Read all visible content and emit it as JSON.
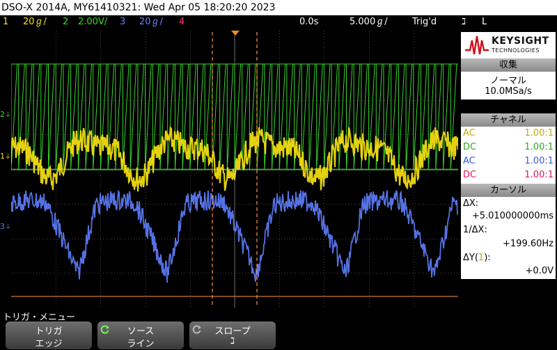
{
  "title": "DSO-X 2014A, MY61410321: Wed Apr 05 18:20:20 2023",
  "status": {
    "ch1": {
      "num": "1",
      "scale": "20ℊ/",
      "color": "#f5e21b"
    },
    "ch2": {
      "num": "2",
      "scale": "2.00V/",
      "color": "#3ddc2b"
    },
    "ch3": {
      "num": "3",
      "scale": "20ℊ/",
      "color": "#6a7fff"
    },
    "ch4": {
      "num": "4",
      "color": "#ff3b6b"
    },
    "delay": "0.0s",
    "timebase": "5.000ℊ/",
    "trig_state": "Trig'd",
    "trig_mode": "ℷ",
    "trig_src": "L"
  },
  "panel": {
    "brand": "KEYSIGHT",
    "brand_sub": "TECHNOLOGIES",
    "acquire_head": "収集",
    "acquire_mode": "ノーマル",
    "acquire_rate": "10.0MSa/s",
    "channel_head": "チャネル",
    "channels": [
      {
        "coupling": "AC",
        "ratio": "1.00:1",
        "color": "#c8a800"
      },
      {
        "coupling": "DC",
        "ratio": "1.00:1",
        "color": "#2ea81f"
      },
      {
        "coupling": "AC",
        "ratio": "1.00:1",
        "color": "#3a55ee"
      },
      {
        "coupling": "DC",
        "ratio": "1.00:1",
        "color": "#e0155a"
      }
    ],
    "cursor_head": "カーソル",
    "dx_label": "ΔX:",
    "dx_value": "+5.010000000ms",
    "invdx_label": "1/ΔX:",
    "invdx_value": "+199.60Hz",
    "dy_label_pre": "ΔY(",
    "dy_label_ch": "1",
    "dy_label_post": "):",
    "dy_value": "+0.0V"
  },
  "menu_label": "トリガ・メニュー",
  "softkeys": [
    {
      "top": "トリガ",
      "bottom": "エッジ"
    },
    {
      "top": "ソース",
      "bottom": "ライン"
    },
    {
      "top": "スロープ",
      "bottom": "ℷ"
    }
  ]
}
